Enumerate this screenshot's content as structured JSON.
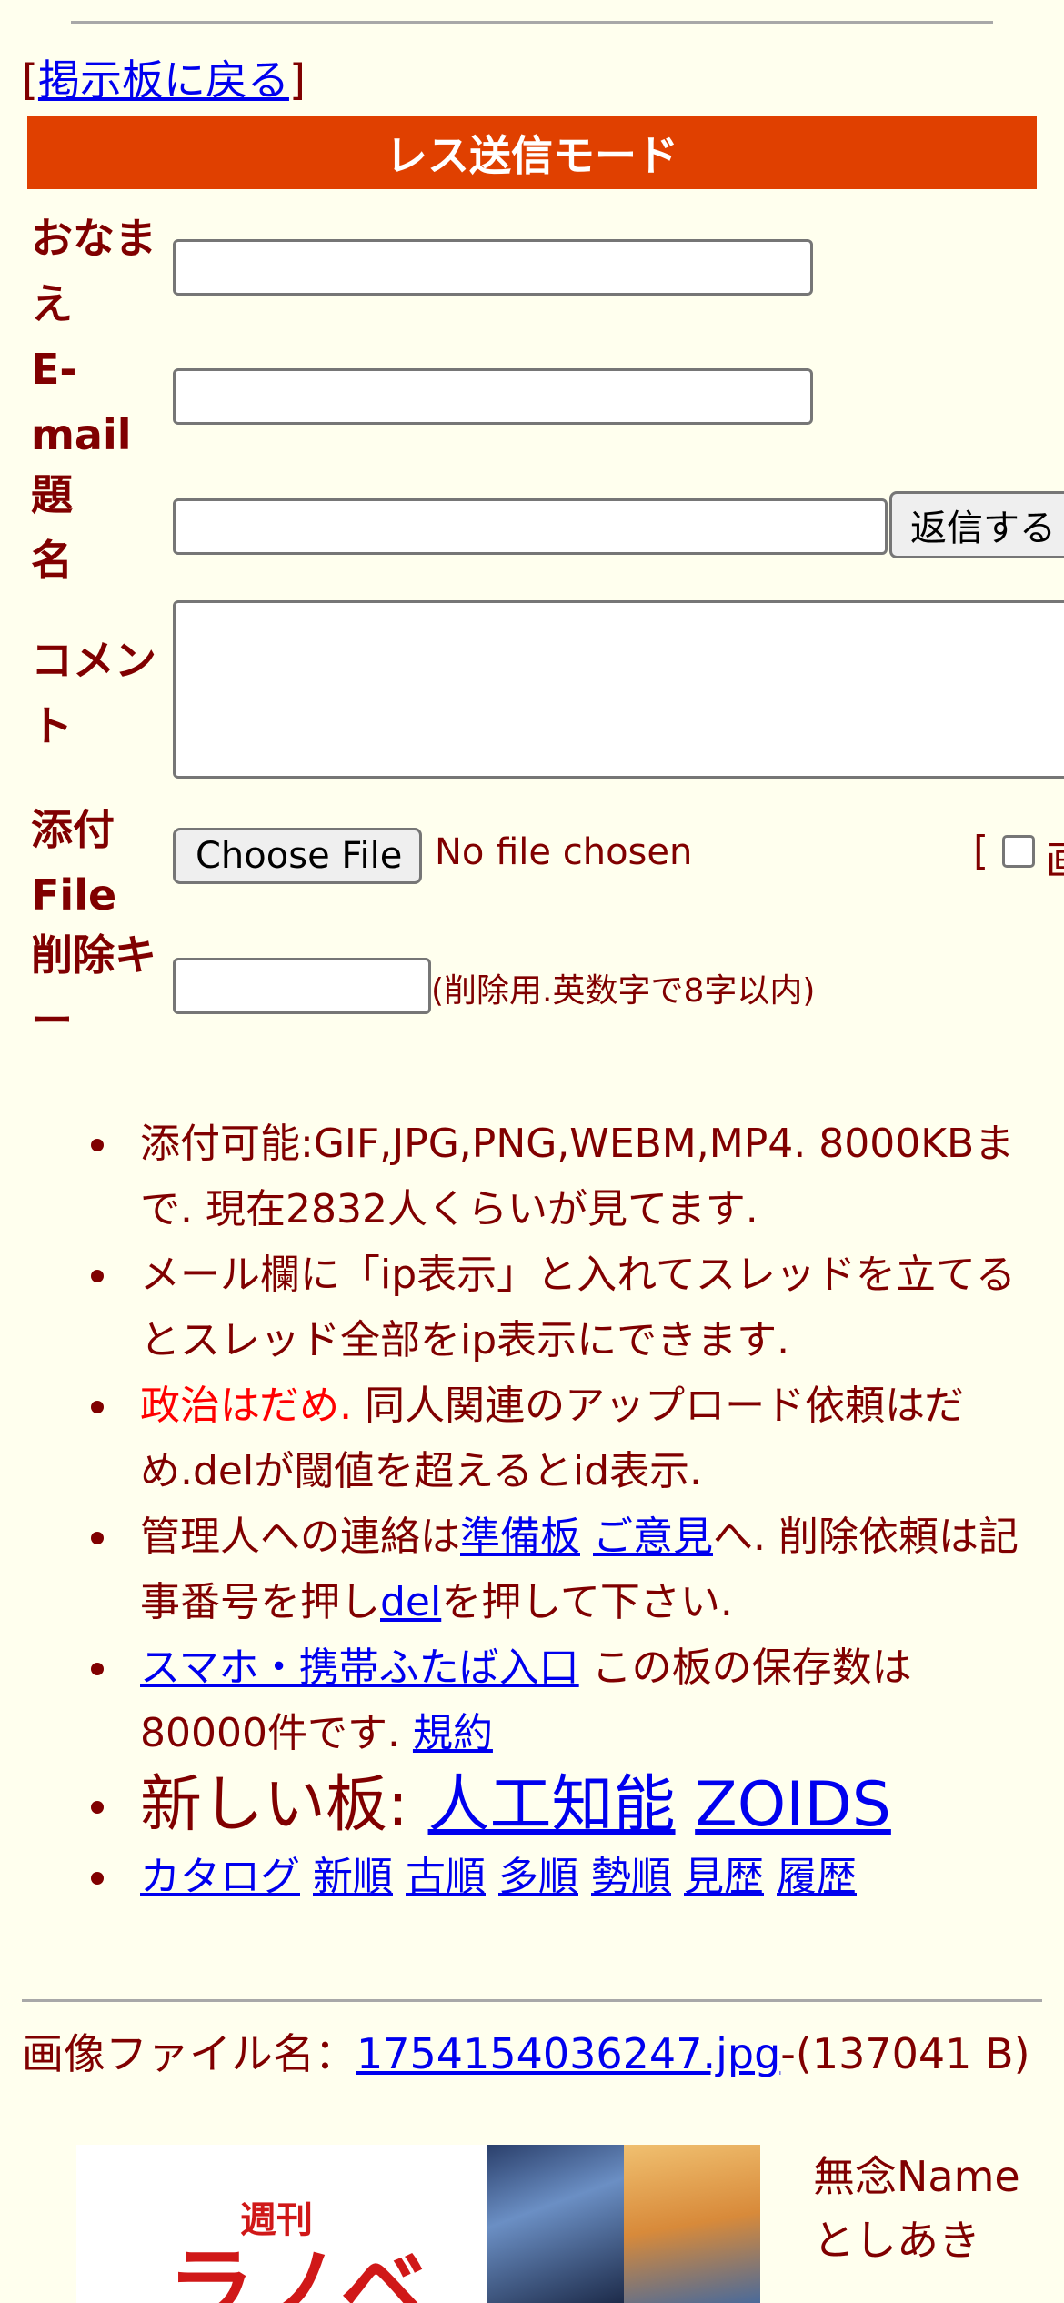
{
  "nav": {
    "back_open": "[",
    "back_link": "掲示板に戻る",
    "back_close": "]"
  },
  "header": {
    "title": "レス送信モード"
  },
  "form": {
    "name_label": "おなまえ",
    "email_label": "E-mail",
    "subject_label": "題名",
    "submit_label": "返信する",
    "comment_label": "コメント",
    "attach_label": "添付File",
    "choose_file_label": "Choose File",
    "no_file_text": "No file chosen",
    "attach_extra_open": "[",
    "attach_extra_label": "画",
    "delete_key_label": "削除キー",
    "delete_key_note": "(削除用.英数字で8字以内)"
  },
  "rules": {
    "r1": "添付可能:GIF,JPG,PNG,WEBM,MP4. 8000KBまで. 現在2832人くらいが見てます.",
    "r2": "メール欄に「ip表示」と入れてスレッドを立てるとスレッド全部をip表示にできます.",
    "r3_red": "政治はだめ.",
    "r3_rest": " 同人関連のアップロード依頼はだめ.delが閾値を超えるとid表示.",
    "r4_a": "管理人への連絡は",
    "r4_link1": "準備板",
    "r4_link2": "ご意見",
    "r4_b": "へ. 削除依頼は記事番号を押し",
    "r4_link3": "del",
    "r4_c": "を押して下さい.",
    "r5_link": "スマホ・携帯ふたば入口",
    "r5_text": " この板の保存数は80000件です. ",
    "r5_link2": "規約",
    "r6_text": "新しい板: ",
    "r6_link1": "人工知能",
    "r6_link2": "ZOIDS",
    "r7_links": [
      "カタログ",
      "新順",
      "古順",
      "多順",
      "勢順",
      "見歴",
      "履歴"
    ]
  },
  "post": {
    "file_label": "画像ファイル名：",
    "file_name": "1754154036247.jpg",
    "file_size": "-(137041 B)",
    "thumb_kicker": "週刊",
    "thumb_big": "ラノベ",
    "poster_name": "無念Name",
    "poster_extra": "としあき"
  },
  "colors": {
    "background": "#ffffee",
    "text": "#800000",
    "header_bar": "#e04000",
    "link": "#0000ee",
    "warning": "#ff0000"
  }
}
